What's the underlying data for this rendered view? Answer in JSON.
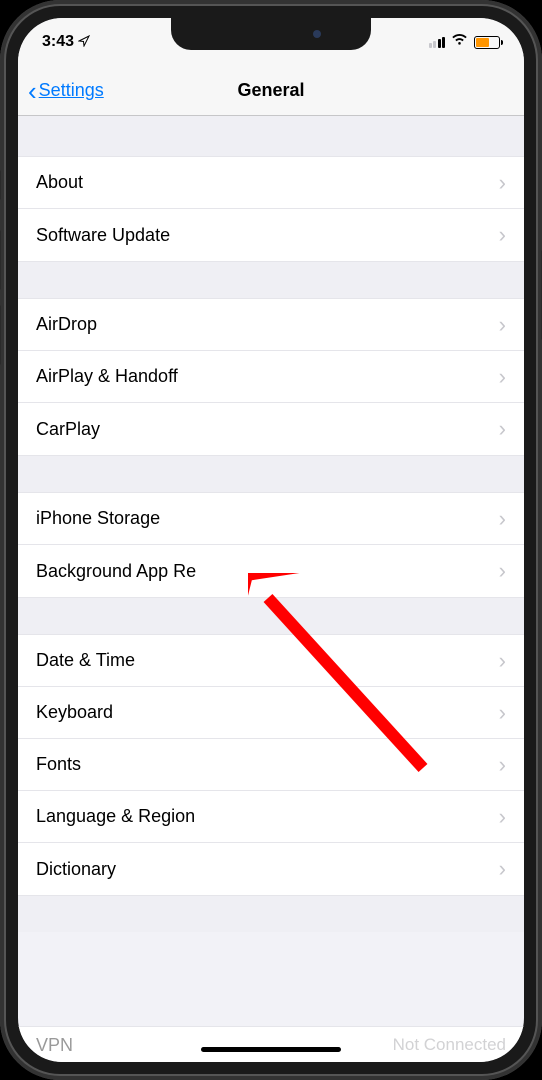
{
  "status": {
    "time": "3:43",
    "battery_color": "#ff9500"
  },
  "nav": {
    "back_label": "Settings",
    "title": "General"
  },
  "groups": [
    {
      "items": [
        {
          "id": "about",
          "label": "About"
        },
        {
          "id": "software-update",
          "label": "Software Update"
        }
      ]
    },
    {
      "items": [
        {
          "id": "airdrop",
          "label": "AirDrop"
        },
        {
          "id": "airplay-handoff",
          "label": "AirPlay & Handoff"
        },
        {
          "id": "carplay",
          "label": "CarPlay"
        }
      ]
    },
    {
      "items": [
        {
          "id": "iphone-storage",
          "label": "iPhone Storage"
        },
        {
          "id": "background-app-refresh",
          "label": "Background App Re"
        }
      ]
    },
    {
      "items": [
        {
          "id": "date-time",
          "label": "Date & Time"
        },
        {
          "id": "keyboard",
          "label": "Keyboard"
        },
        {
          "id": "fonts",
          "label": "Fonts"
        },
        {
          "id": "language-region",
          "label": "Language & Region"
        },
        {
          "id": "dictionary",
          "label": "Dictionary"
        }
      ]
    }
  ],
  "partial": {
    "left": "VPN",
    "right": "Not Connected"
  },
  "annotation": {
    "type": "arrow",
    "points_to": "iphone-storage",
    "color": "#ff0000"
  }
}
